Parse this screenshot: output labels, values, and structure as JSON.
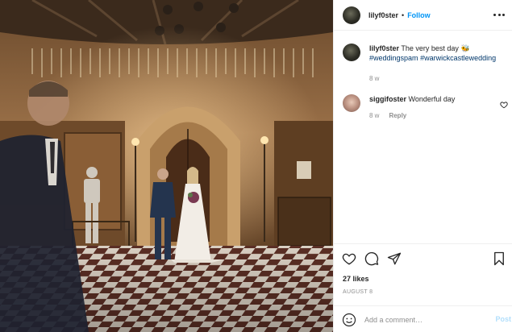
{
  "post": {
    "author": "lilyf0ster",
    "follow_label": "Follow",
    "separator": "•",
    "photo_alt": "Bride walking with her father down the aisle of a castle great hall"
  },
  "caption": {
    "username": "lilyf0ster",
    "text": "The very best day",
    "emoji": "🐝",
    "hashtags": [
      "#weddingspam",
      "#warwickcastlewedding"
    ],
    "age": "8 w"
  },
  "comments": [
    {
      "username": "siggifoster",
      "text": "Wonderful day",
      "age": "8 w",
      "reply_label": "Reply"
    }
  ],
  "likes": "27 likes",
  "date": "AUGUST 8",
  "add_comment": {
    "placeholder": "Add a comment…",
    "post_label": "Post"
  },
  "icons": {
    "more": "more-options-icon",
    "like": "heart-icon",
    "comment": "comment-bubble-icon",
    "share": "paper-plane-icon",
    "save": "bookmark-icon",
    "emoji": "smiley-icon",
    "comment_like": "small-heart-icon"
  },
  "colors": {
    "accent": "#0095f6",
    "hashtag": "#00376b",
    "muted": "#8e8e8e",
    "post_disabled": "#b2dffc"
  }
}
